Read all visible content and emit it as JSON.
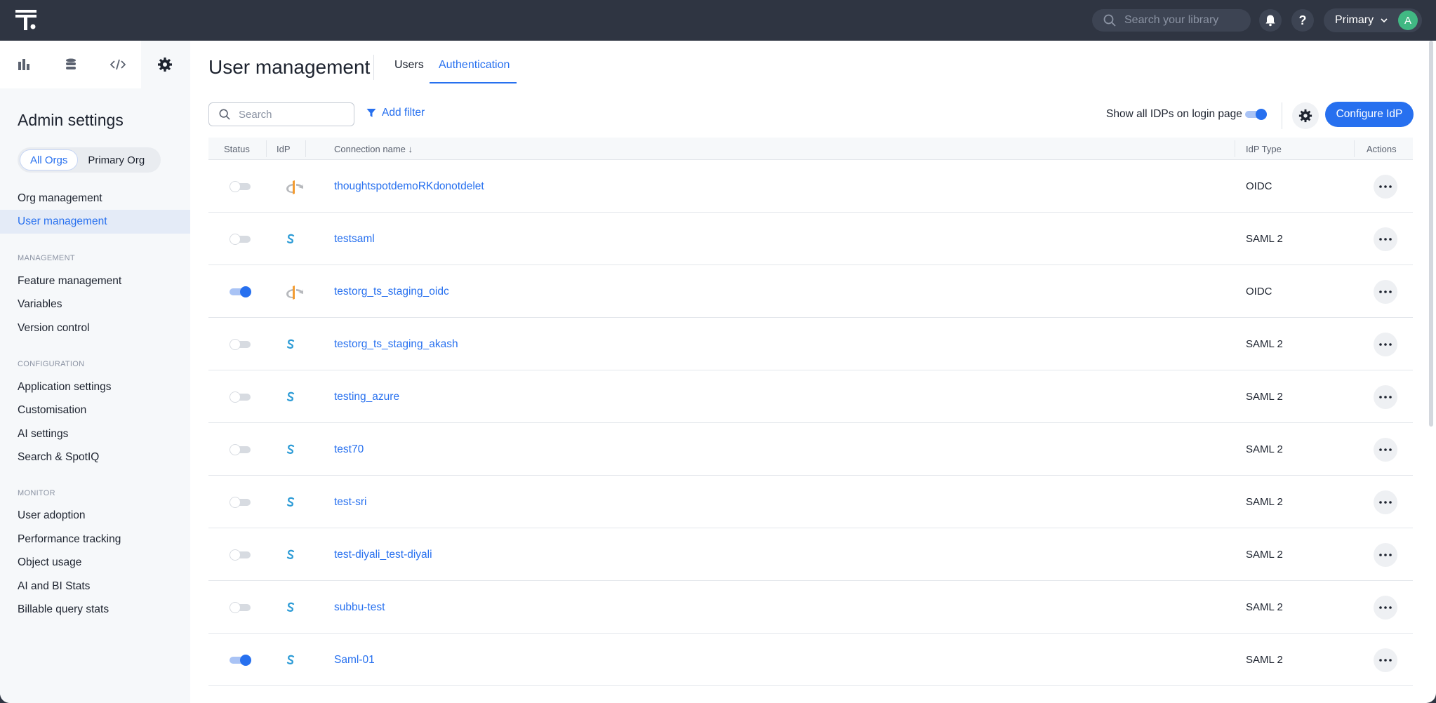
{
  "topbar": {
    "search_placeholder": "Search your library",
    "org_label": "Primary",
    "avatar_initial": "A",
    "help_label": "?"
  },
  "sidebar": {
    "title": "Admin settings",
    "org_toggle": [
      "All Orgs",
      "Primary Org"
    ],
    "top_items": [
      "Org management",
      "User management"
    ],
    "sections": [
      {
        "label": "MANAGEMENT",
        "items": [
          "Feature management",
          "Variables",
          "Version control"
        ]
      },
      {
        "label": "CONFIGURATION",
        "items": [
          "Application settings",
          "Customisation",
          "AI settings",
          "Search & SpotIQ"
        ]
      },
      {
        "label": "MONITOR",
        "items": [
          "User adoption",
          "Performance tracking",
          "Object usage",
          "AI and BI Stats",
          "Billable query stats"
        ]
      }
    ]
  },
  "page": {
    "title": "User management",
    "tabs": [
      "Users",
      "Authentication"
    ],
    "search_placeholder": "Search",
    "add_filter": "Add filter",
    "show_idps_label": "Show all IDPs on login page",
    "show_idps_on": true,
    "configure_button": "Configure IdP"
  },
  "table": {
    "headers": {
      "status": "Status",
      "idp": "IdP",
      "name": "Connection name ↓",
      "type": "IdP Type",
      "actions": "Actions"
    },
    "rows": [
      {
        "enabled": false,
        "icon": "oidc-icon",
        "name": "thoughtspotdemoRKdonotdelet",
        "type": "OIDC"
      },
      {
        "enabled": false,
        "icon": "saml-icon",
        "name": "testsaml",
        "type": "SAML 2"
      },
      {
        "enabled": true,
        "icon": "oidc-icon",
        "name": "testorg_ts_staging_oidc",
        "type": "OIDC"
      },
      {
        "enabled": false,
        "icon": "saml-icon",
        "name": "testorg_ts_staging_akash",
        "type": "SAML 2"
      },
      {
        "enabled": false,
        "icon": "saml-icon",
        "name": "testing_azure",
        "type": "SAML 2"
      },
      {
        "enabled": false,
        "icon": "saml-icon",
        "name": "test70",
        "type": "SAML 2"
      },
      {
        "enabled": false,
        "icon": "saml-icon",
        "name": "test-sri",
        "type": "SAML 2"
      },
      {
        "enabled": false,
        "icon": "saml-icon",
        "name": "test-diyali_test-diyali",
        "type": "SAML 2"
      },
      {
        "enabled": false,
        "icon": "saml-icon",
        "name": "subbu-test",
        "type": "SAML 2"
      },
      {
        "enabled": true,
        "icon": "saml-icon",
        "name": "Saml-01",
        "type": "SAML 2"
      }
    ]
  },
  "colors": {
    "accent": "#2770ef",
    "topbar": "#2f3542",
    "avatar": "#41b883"
  }
}
